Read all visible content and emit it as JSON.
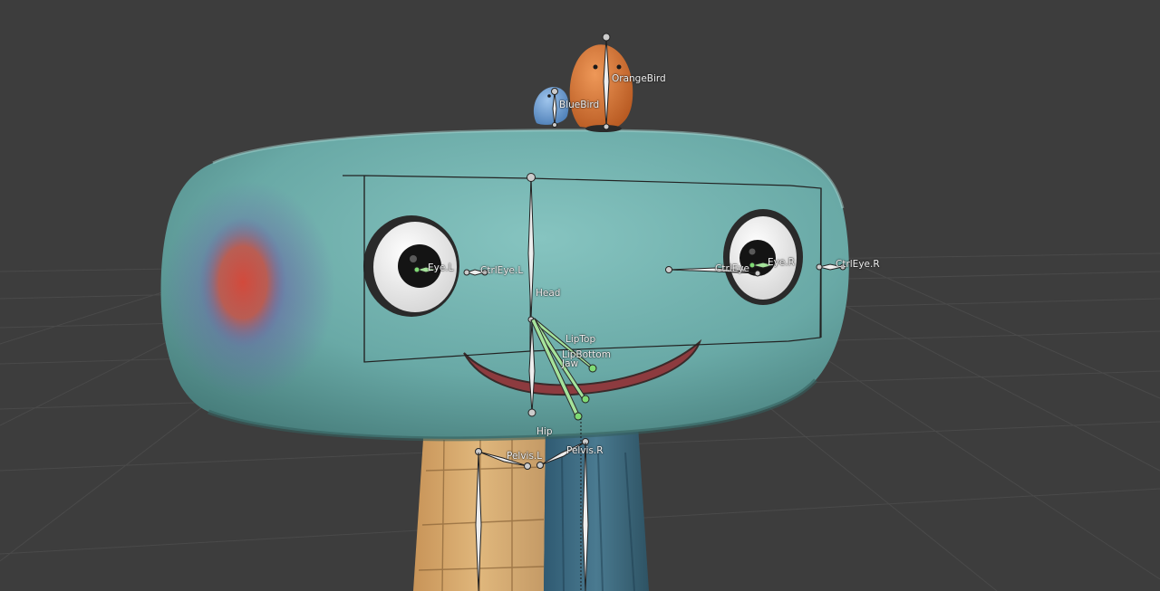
{
  "viewport": {
    "background": "#3d3d3d",
    "grid_color": "#4a4a4a",
    "colors": {
      "head": "#6fb0ad",
      "head_shade": "#4f8a88",
      "cheek_red": "#c8493b",
      "cheek_purple": "#5c5ea0",
      "eye_white": "#f2f2f2",
      "pupil": "#151515",
      "mouth": "#8d3b3f",
      "neck_left": "#d9a96b",
      "neck_right": "#3f6f86",
      "orange_bird": "#d2702e",
      "blue_bird": "#6e9fd2",
      "bone_default": "#eeeeee",
      "bone_selected": "#7fdb74"
    },
    "objects": {
      "head_mesh": "Head mesh",
      "orange_bird": "OrangeBird",
      "blue_bird": "BlueBird"
    }
  },
  "bones": {
    "orange_bird": "OrangeBird",
    "blue_bird": "BlueBird",
    "eye_l": "Eye.L",
    "ctrl_eye_l": "CtrlEye.L",
    "ctrl_eye": "CtrlEye",
    "eye_r": "Eye.R",
    "ctrl_eye_r": "CtrlEye.R",
    "head": "Head",
    "lip_top": "LipTop",
    "lip_bottom": "LipBottom",
    "jaw": "Jaw",
    "hip": "Hip",
    "pelvis_l": "Pelvis.L",
    "pelvis_r": "Pelvis.R"
  }
}
